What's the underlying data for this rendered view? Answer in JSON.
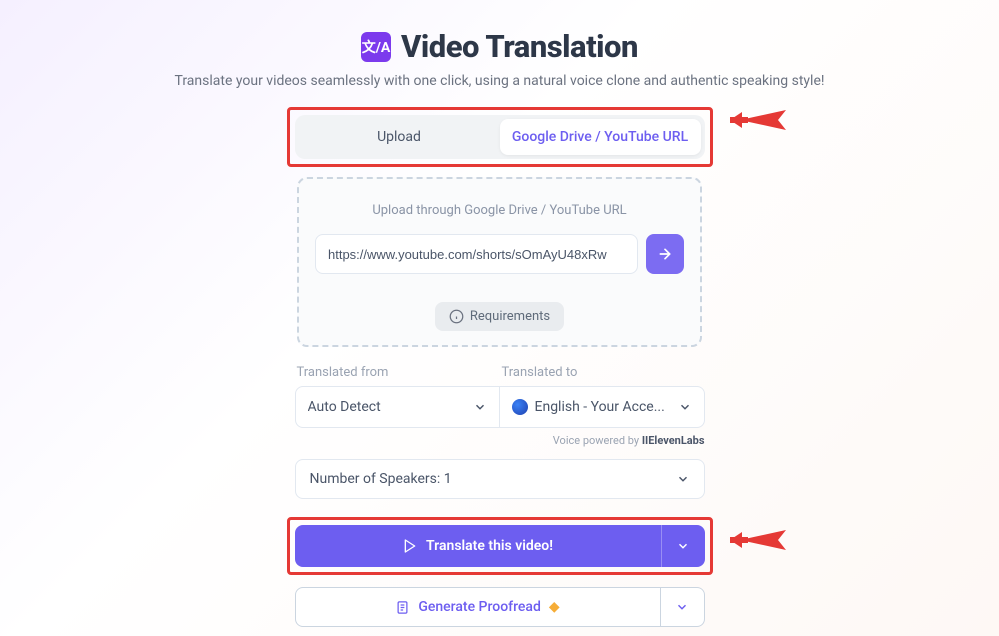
{
  "header": {
    "title": "Video Translation",
    "subtitle": "Translate your videos seamlessly with one click, using a natural voice clone and authentic speaking style!",
    "logo_text": "文/A"
  },
  "tabs": {
    "upload": "Upload",
    "url": "Google Drive / YouTube URL"
  },
  "upload_panel": {
    "caption": "Upload through Google Drive / YouTube URL",
    "url_value": "https://www.youtube.com/shorts/sOmAyU48xRw",
    "requirements_label": "Requirements"
  },
  "translate": {
    "from_label": "Translated from",
    "from_value": "Auto Detect",
    "to_label": "Translated to",
    "to_value": "English - Your Acce..."
  },
  "voice_credit": {
    "prefix": "Voice powered by ",
    "brand": "IIElevenLabs"
  },
  "speakers": {
    "label": "Number of Speakers: 1"
  },
  "primary": {
    "label": "Translate this video!"
  },
  "secondary": {
    "label": "Generate Proofread"
  }
}
